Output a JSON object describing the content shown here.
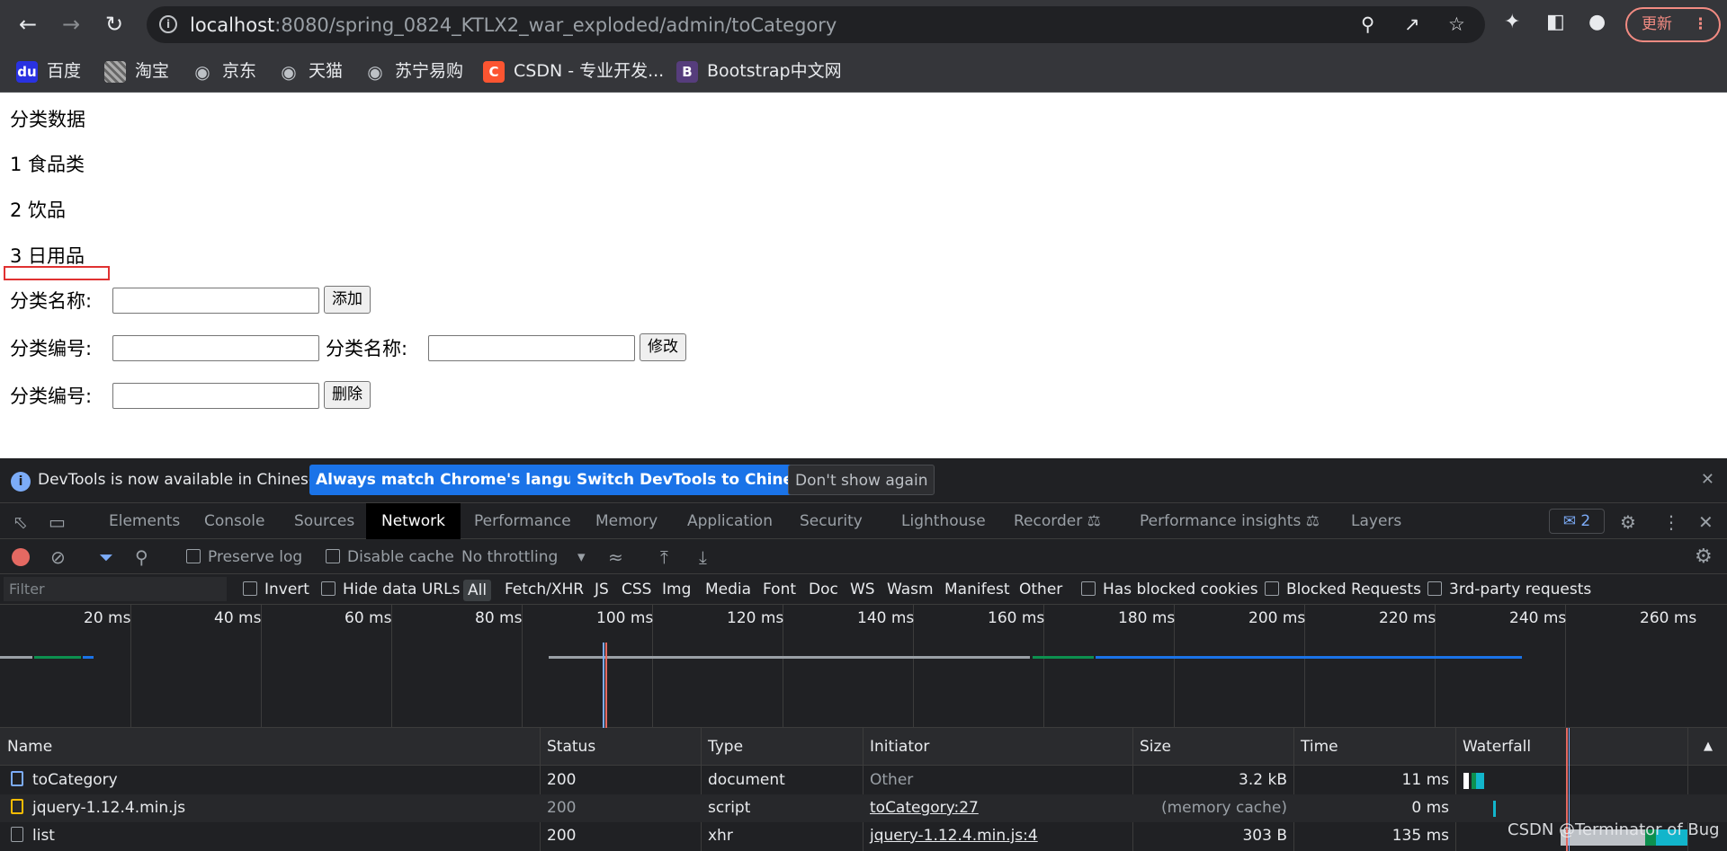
{
  "browser": {
    "url_host": "localhost",
    "url_rest": ":8080/spring_0824_KTLX2_war_exploded/admin/toCategory",
    "update_label": "更新",
    "bookmarks": [
      {
        "label": "百度",
        "icon": "baidu-icon"
      },
      {
        "label": "淘宝",
        "icon": "taobao-icon"
      },
      {
        "label": "京东",
        "icon": "globe-icon"
      },
      {
        "label": "天猫",
        "icon": "globe-icon"
      },
      {
        "label": "苏宁易购",
        "icon": "globe-icon"
      },
      {
        "label": "CSDN - 专业开发...",
        "icon": "csdn-icon"
      },
      {
        "label": "Bootstrap中文网",
        "icon": "bootstrap-icon"
      }
    ]
  },
  "page": {
    "heading": "分类数据",
    "categories": [
      "1 食品类",
      "2 饮品",
      "3 日用品"
    ],
    "form_add": {
      "label": "分类名称:",
      "button": "添加"
    },
    "form_update": {
      "id_label": "分类编号:",
      "name_label": "分类名称:",
      "button": "修改"
    },
    "form_delete": {
      "label": "分类编号:",
      "button": "删除"
    }
  },
  "devtools": {
    "infobar": {
      "text": "DevTools is now available in Chinese!",
      "btn_match": "Always match Chrome's language",
      "btn_switch": "Switch DevTools to Chinese",
      "btn_dismiss": "Don't show again"
    },
    "tabs": [
      "Elements",
      "Console",
      "Sources",
      "Network",
      "Performance",
      "Memory",
      "Application",
      "Security",
      "Lighthouse",
      "Recorder",
      "Performance insights",
      "Layers"
    ],
    "active_tab": "Network",
    "issues_count": "2",
    "toolbar": {
      "preserve_log": "Preserve log",
      "disable_cache": "Disable cache",
      "throttling": "No throttling"
    },
    "filter": {
      "placeholder": "Filter",
      "invert": "Invert",
      "hide_data_urls": "Hide data URLs",
      "types": [
        "All",
        "Fetch/XHR",
        "JS",
        "CSS",
        "Img",
        "Media",
        "Font",
        "Doc",
        "WS",
        "Wasm",
        "Manifest",
        "Other"
      ],
      "has_blocked_cookies": "Has blocked cookies",
      "blocked_requests": "Blocked Requests",
      "third_party": "3rd-party requests"
    },
    "timeline_labels": [
      "20 ms",
      "40 ms",
      "60 ms",
      "80 ms",
      "100 ms",
      "120 ms",
      "140 ms",
      "160 ms",
      "180 ms",
      "200 ms",
      "220 ms",
      "240 ms",
      "260 ms"
    ],
    "columns": [
      "Name",
      "Status",
      "Type",
      "Initiator",
      "Size",
      "Time",
      "Waterfall"
    ],
    "requests": [
      {
        "name": "toCategory",
        "status": "200",
        "type": "document",
        "initiator": "Other",
        "size": "3.2 kB",
        "time": "11 ms"
      },
      {
        "name": "jquery-1.12.4.min.js",
        "status": "200",
        "type": "script",
        "initiator": "toCategory:27",
        "size": "(memory cache)",
        "time": "0 ms"
      },
      {
        "name": "list",
        "status": "200",
        "type": "xhr",
        "initiator": "jquery-1.12.4.min.js:4",
        "size": "303 B",
        "time": "135 ms"
      }
    ]
  },
  "watermark": "CSDN @Terminator of Bug"
}
